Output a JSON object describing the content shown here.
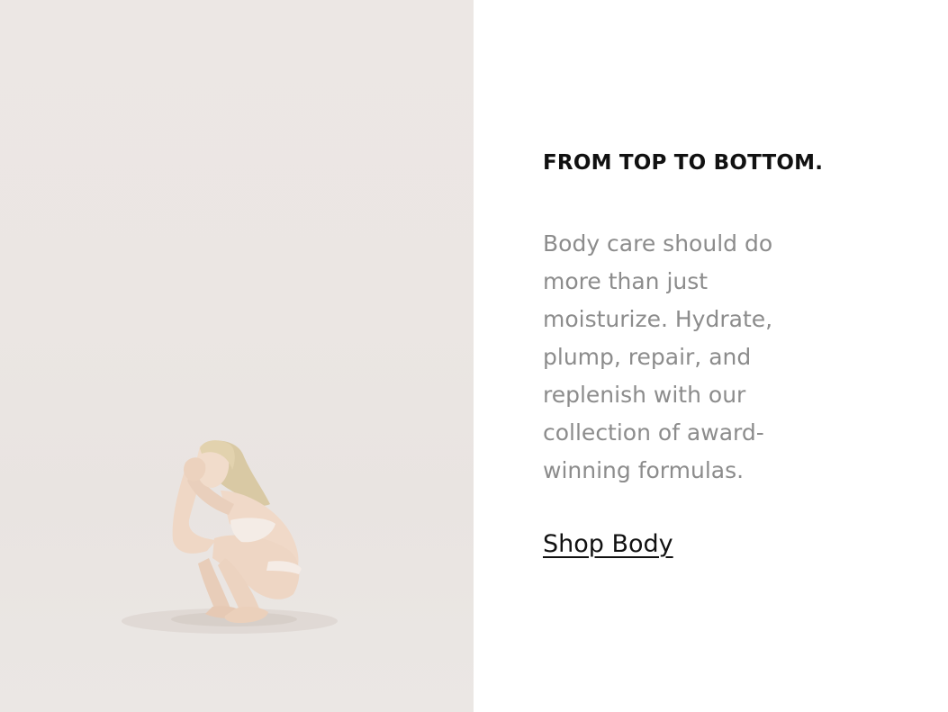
{
  "hero_image": {
    "subject": "model-crouching"
  },
  "promo": {
    "heading": "FROM TOP TO BOTTOM.",
    "body": "Body care should do more than just moisturize. Hydrate, plump, repair, and replenish with our collection of award-winning formulas.",
    "link_label": "Shop Body"
  },
  "colors": {
    "photo_background": "#ebe6e3",
    "heading_text": "#111111",
    "body_text": "#8c8c8c",
    "link_text": "#111111",
    "page_background": "#ffffff"
  }
}
